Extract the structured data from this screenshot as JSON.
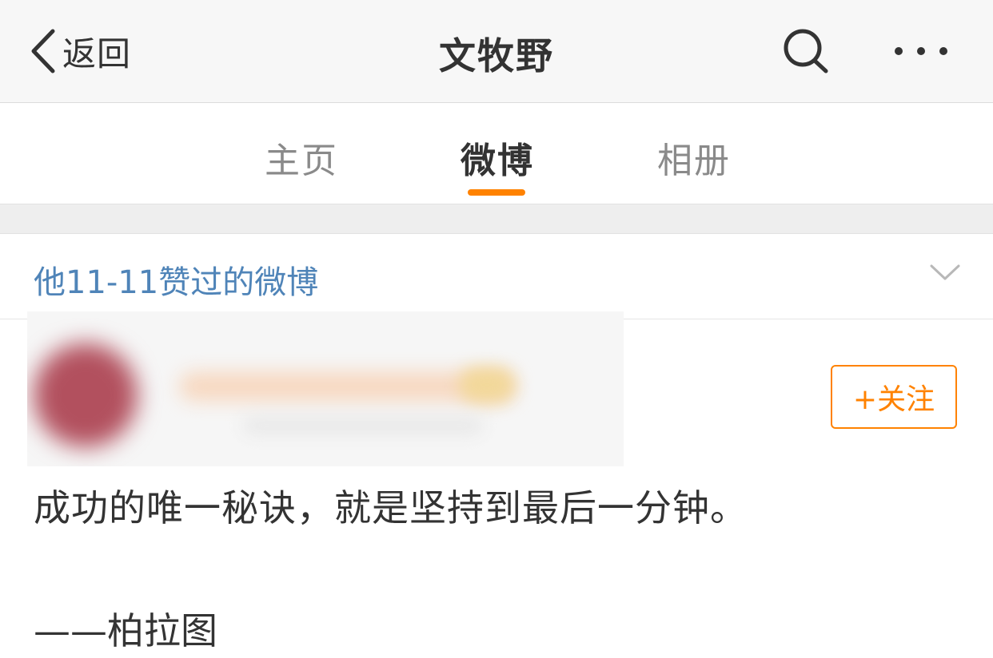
{
  "navbar": {
    "back_label": "返回",
    "title": "文牧野",
    "icons": [
      "chevron-left-icon",
      "search-icon",
      "more-icon"
    ]
  },
  "tabs": [
    {
      "label": "主页",
      "active": false
    },
    {
      "label": "微博",
      "active": true
    },
    {
      "label": "相册",
      "active": false
    }
  ],
  "filter": {
    "label": "他11-11赞过的微博",
    "icon": "chevron-down-icon"
  },
  "post": {
    "follow_label": "+关注",
    "text": "成功的唯一秘诀，就是坚持到最后一分钟。",
    "attribution": "——柏拉图"
  },
  "colors": {
    "accent": "#ff8200",
    "link": "#4f84b8",
    "text": "#333333",
    "muted": "#8a8a8a"
  }
}
